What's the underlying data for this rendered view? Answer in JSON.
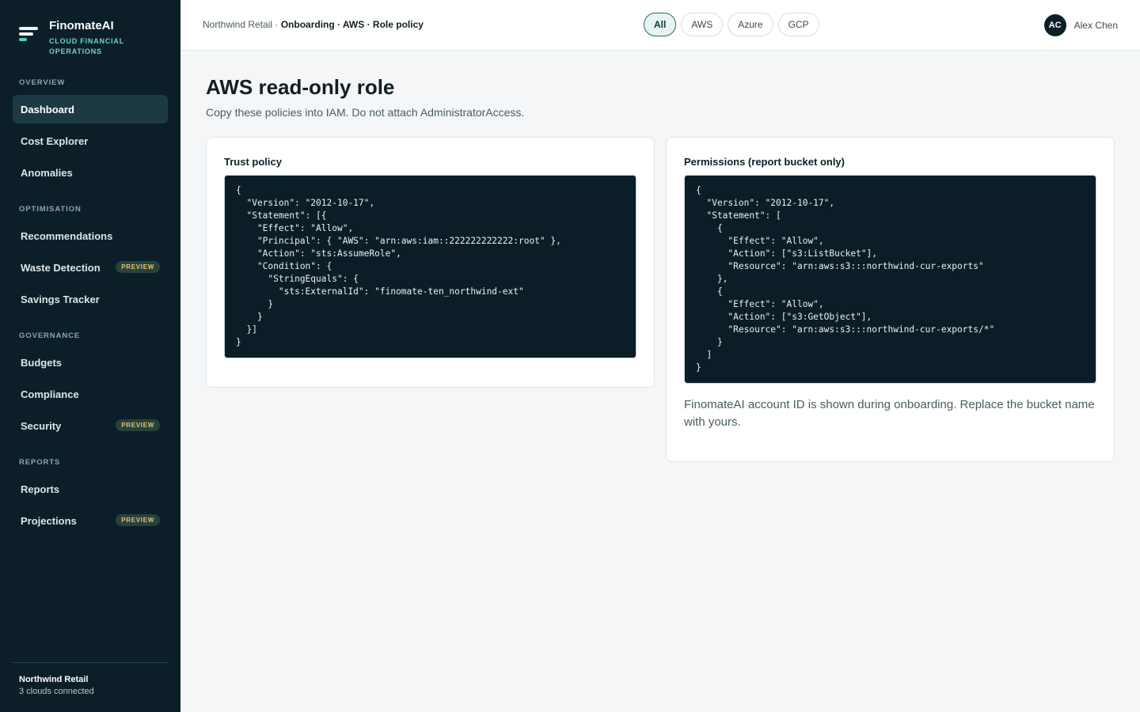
{
  "brand": {
    "name": "FinomateAI",
    "tagline": "CLOUD FINANCIAL OPERATIONS"
  },
  "sidebar": {
    "sections": [
      {
        "title": "OVERVIEW",
        "items": [
          {
            "label": "Dashboard",
            "active": true
          },
          {
            "label": "Cost Explorer"
          },
          {
            "label": "Anomalies"
          }
        ]
      },
      {
        "title": "OPTIMISATION",
        "items": [
          {
            "label": "Recommendations"
          },
          {
            "label": "Waste Detection",
            "badge": "PREVIEW"
          },
          {
            "label": "Savings Tracker"
          }
        ]
      },
      {
        "title": "GOVERNANCE",
        "items": [
          {
            "label": "Budgets"
          },
          {
            "label": "Compliance"
          },
          {
            "label": "Security",
            "badge": "PREVIEW"
          }
        ]
      },
      {
        "title": "REPORTS",
        "items": [
          {
            "label": "Reports"
          },
          {
            "label": "Projections",
            "badge": "PREVIEW"
          }
        ]
      }
    ],
    "footer": {
      "org": "Northwind Retail",
      "status": "3 clouds connected"
    }
  },
  "header": {
    "breadcrumb": {
      "root": "Northwind Retail · ",
      "path": "Onboarding · AWS · Role policy"
    },
    "cloud_tabs": [
      {
        "label": "All",
        "active": true
      },
      {
        "label": "AWS"
      },
      {
        "label": "Azure"
      },
      {
        "label": "GCP"
      }
    ],
    "user": {
      "initials": "AC",
      "name": "Alex Chen"
    }
  },
  "main": {
    "title": "AWS read-only role",
    "subtitle": "Copy these policies into IAM. Do not attach AdministratorAccess.",
    "trust_policy": {
      "title": "Trust policy",
      "code": "{\n  \"Version\": \"2012-10-17\",\n  \"Statement\": [{\n    \"Effect\": \"Allow\",\n    \"Principal\": { \"AWS\": \"arn:aws:iam::222222222222:root\" },\n    \"Action\": \"sts:AssumeRole\",\n    \"Condition\": {\n      \"StringEquals\": {\n        \"sts:ExternalId\": \"finomate-ten_northwind-ext\"\n      }\n    }\n  }]\n}"
    },
    "permissions_policy": {
      "title": "Permissions (report bucket only)",
      "code": "{\n  \"Version\": \"2012-10-17\",\n  \"Statement\": [\n    {\n      \"Effect\": \"Allow\",\n      \"Action\": [\"s3:ListBucket\"],\n      \"Resource\": \"arn:aws:s3:::northwind-cur-exports\"\n    },\n    {\n      \"Effect\": \"Allow\",\n      \"Action\": [\"s3:GetObject\"],\n      \"Resource\": \"arn:aws:s3:::northwind-cur-exports/*\"\n    }\n  ]\n}",
      "note": "FinomateAI account ID is shown during onboarding. Replace the bucket name with yours."
    }
  }
}
